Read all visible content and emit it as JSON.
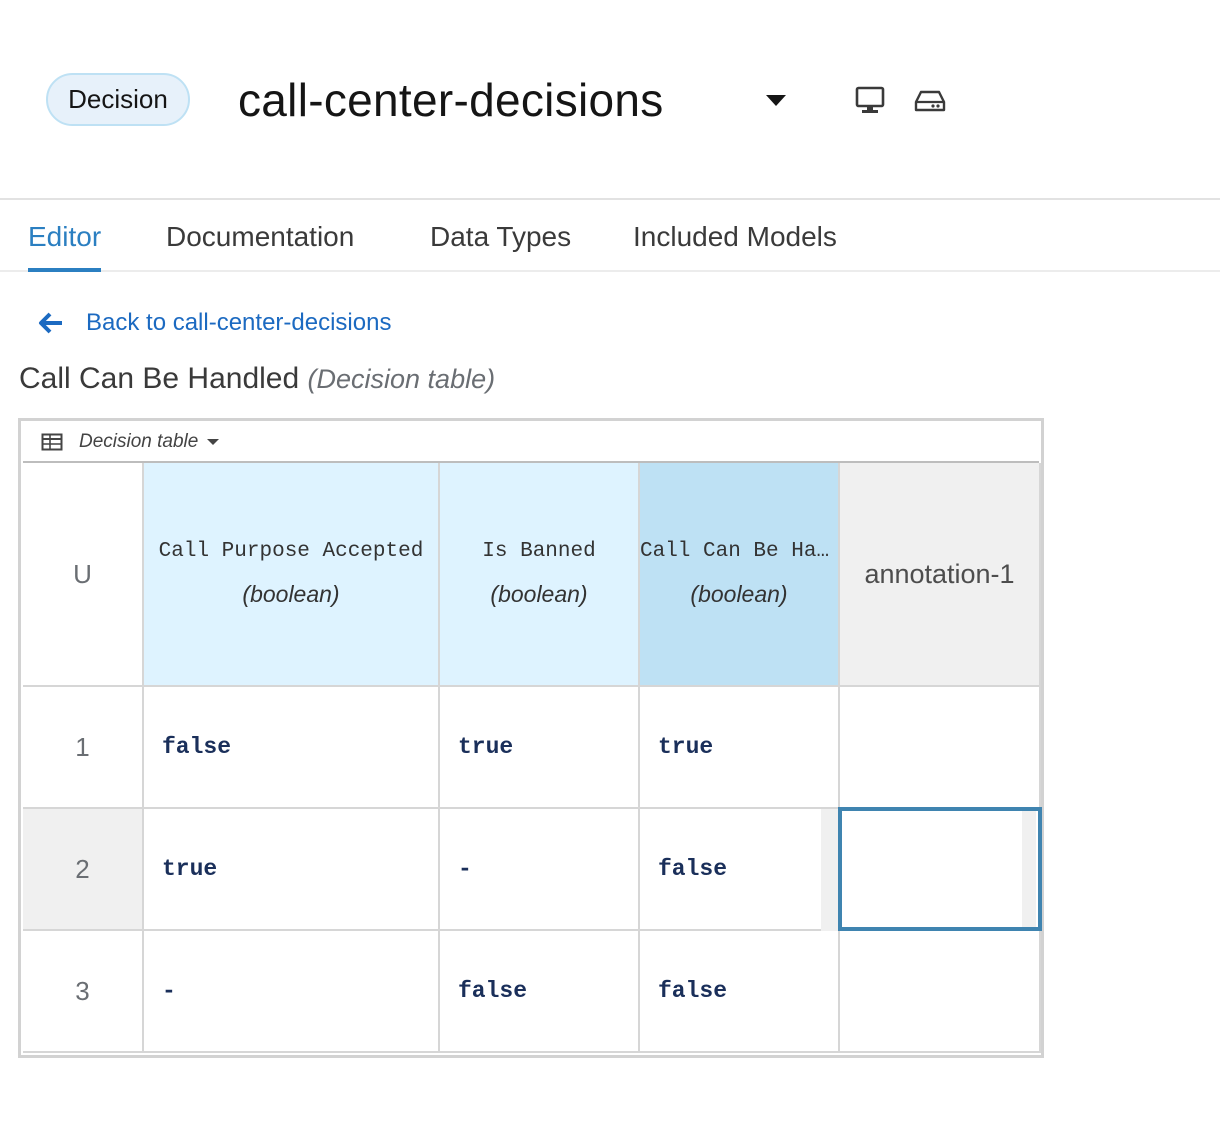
{
  "header": {
    "badge": "Decision",
    "model_name": "call-center-decisions",
    "icons": [
      "caret-down-icon",
      "monitor-icon",
      "hard-drive-icon"
    ]
  },
  "tabs": [
    {
      "label": "Editor",
      "active": true
    },
    {
      "label": "Documentation",
      "active": false
    },
    {
      "label": "Data Types",
      "active": false
    },
    {
      "label": "Included Models",
      "active": false
    }
  ],
  "back_link": {
    "label": "Back to call-center-decisions",
    "icon": "arrow-left-icon"
  },
  "page_heading": {
    "name": "Call Can Be Handled",
    "kind": "(Decision table)"
  },
  "decision_table": {
    "toolbar_label": "Decision table",
    "hit_policy": "U",
    "columns": [
      {
        "name": "Call Purpose Accepted",
        "type": "(boolean)",
        "kind": "input"
      },
      {
        "name": "Is Banned",
        "type": "(boolean)",
        "kind": "input"
      },
      {
        "name": "Call Can Be Han…",
        "type": "(boolean)",
        "kind": "output"
      },
      {
        "name": "annotation-1",
        "kind": "annotation"
      }
    ],
    "rows": [
      {
        "number": "1",
        "cells": [
          "false",
          "true",
          "true",
          ""
        ]
      },
      {
        "number": "2",
        "cells": [
          "true",
          "-",
          "false",
          ""
        ]
      },
      {
        "number": "3",
        "cells": [
          "-",
          "false",
          "false",
          ""
        ]
      }
    ],
    "colors": {
      "input": "#def3ff",
      "output": "#bee1f4",
      "annotation": "#f0f0f0",
      "selection": "#3f84b0"
    }
  }
}
